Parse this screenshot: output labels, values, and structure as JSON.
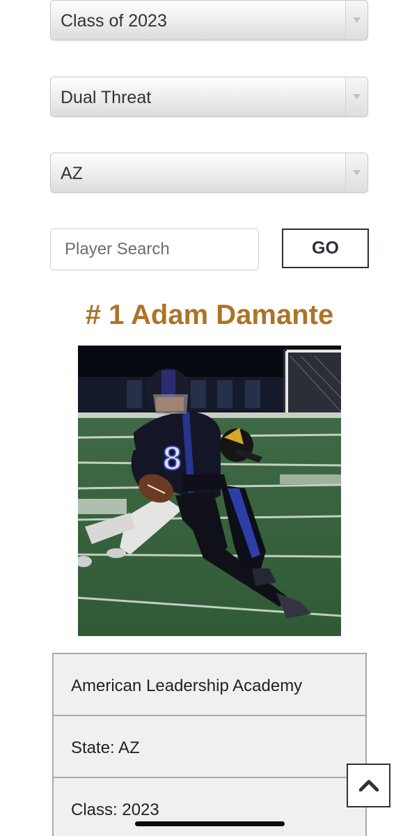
{
  "filters": {
    "class_select": {
      "value": "Class of 2023"
    },
    "position_select": {
      "value": "Dual Threat"
    },
    "state_select": {
      "value": "AZ"
    }
  },
  "search": {
    "placeholder": "Player Search",
    "go_label": "GO"
  },
  "player": {
    "title": "# 1 Adam Damante",
    "school": "American Leadership Academy",
    "state": "State: AZ",
    "class": "Class: 2023"
  },
  "colors": {
    "title_gold": "#ad7327",
    "button_border": "#2b2f3a",
    "table_bg": "#f0f0f0"
  },
  "icons": {
    "select_arrow": "chevron-down-icon",
    "scroll_top": "chevron-up-icon"
  }
}
